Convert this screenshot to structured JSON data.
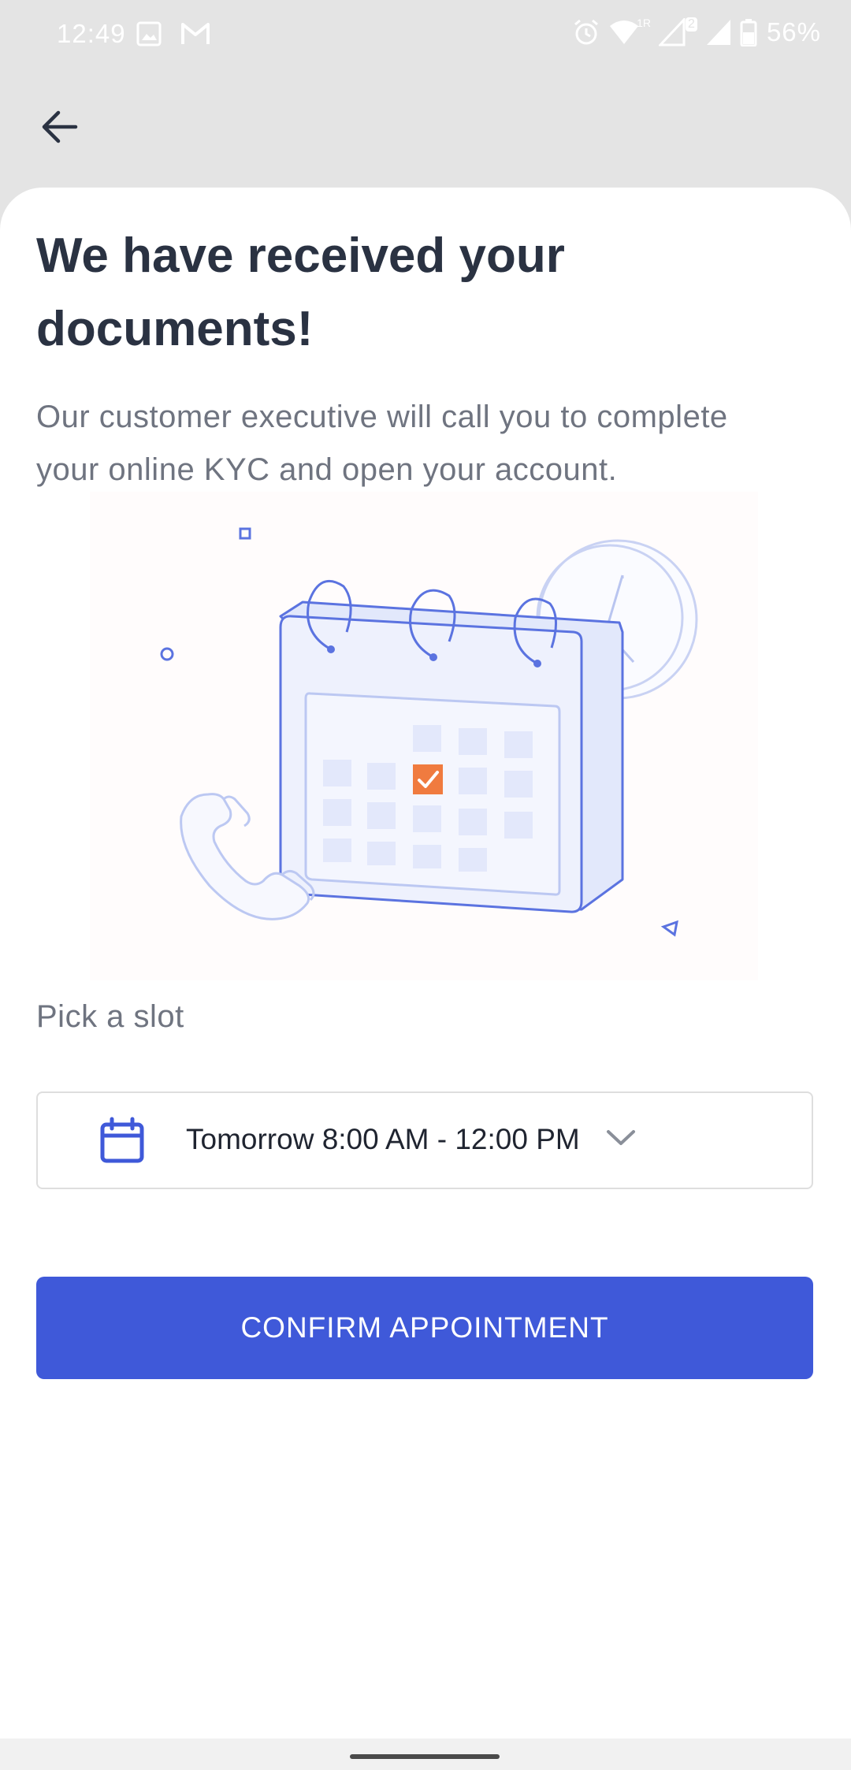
{
  "status_bar": {
    "time": "12:49",
    "network_label": "1R",
    "sim_badge": "2",
    "battery": "56%",
    "icons": [
      "image-icon",
      "gmail-icon",
      "alarm-icon",
      "wifi-icon",
      "signal-icon",
      "signal-icon",
      "battery-icon"
    ]
  },
  "header": {
    "back_icon": "arrow-left-icon"
  },
  "content": {
    "title": "We have received your documents!",
    "subtitle": "Our customer executive will call you to complete your online KYC and open your account.",
    "illustration": "calendar-phone-clock-illustration"
  },
  "slot": {
    "label": "Pick a slot",
    "value": "Tomorrow 8:00 AM - 12:00 PM",
    "icon": "calendar-icon",
    "chevron_icon": "chevron-down-icon"
  },
  "confirm_button": {
    "label": "CONFIRM APPOINTMENT"
  },
  "colors": {
    "primary": "#3f59d9",
    "accent_check": "#f07b3f",
    "illustration_line": "#5b73e0",
    "title_text": "#2a3242",
    "secondary_text": "#6f7480",
    "header_bg": "#e4e4e4"
  }
}
